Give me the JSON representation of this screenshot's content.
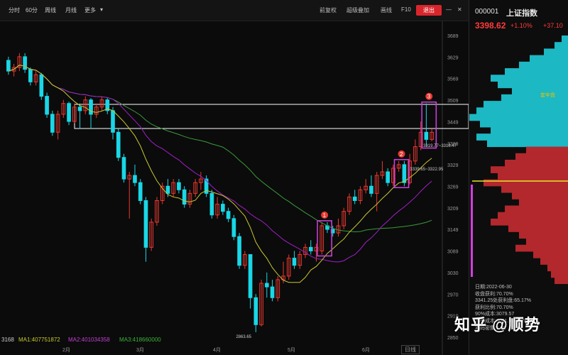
{
  "toolbar": {
    "left": [
      "分时",
      "60分",
      "周线",
      "月线",
      "更多"
    ],
    "right": [
      "前复权",
      "超级叠加",
      "画线",
      "F10"
    ],
    "close_label": "退出"
  },
  "stock": {
    "code": "000001",
    "name": "上证指数",
    "price": "3398.62",
    "pct": "+1.10%",
    "change": "+37.10"
  },
  "side_info": {
    "date": "日期:2022-06-30",
    "profit": "收盘获利:70.70%",
    "range1": "3341.25处获利盘:65.17%",
    "avg": "获利比例:70.70%",
    "line4": "90%成本:3079.57",
    "line5": "70%成本:3091.96-3478.10",
    "line6": "筹码密集:1.60"
  },
  "profile_label": "套牢盘",
  "watermark": "知乎 @顺势",
  "bottom_button": "日线",
  "legend": {
    "value": "3168",
    "ma1": "MA1:407751872",
    "ma2": "MA2:401034358",
    "ma3": "MA3:418660000"
  },
  "colors": {
    "up": "#e8382f",
    "down": "#19d7e6",
    "ma_yellow": "#c8c832",
    "ma_purple": "#a020c8",
    "ma_green": "#3c9a3c",
    "box_white": "#ffffff",
    "highlight": "#d040e0"
  },
  "annotations": {
    "low_label": "2863.65",
    "label2": "3339.65~3322.95",
    "label3": "3319.77~3318.47",
    "markers": [
      "1",
      "2",
      "3"
    ]
  },
  "chart_data": {
    "type": "candlestick",
    "title": "",
    "x_tick_labels": [
      "2月",
      "3月",
      "4月",
      "5月",
      "6月"
    ],
    "y_tick_labels": [
      "3689",
      "3629",
      "3569",
      "3509",
      "3449",
      "3389",
      "3329",
      "3269",
      "3209",
      "3149",
      "3089",
      "3030",
      "2970",
      "2910",
      "2850"
    ],
    "ylim": [
      2850,
      3689
    ],
    "candles": [
      {
        "o": 3620,
        "c": 3590,
        "h": 3630,
        "l": 3580
      },
      {
        "o": 3590,
        "c": 3600,
        "h": 3610,
        "l": 3575
      },
      {
        "o": 3600,
        "c": 3630,
        "h": 3640,
        "l": 3590
      },
      {
        "o": 3630,
        "c": 3595,
        "h": 3640,
        "l": 3585
      },
      {
        "o": 3595,
        "c": 3560,
        "h": 3600,
        "l": 3550
      },
      {
        "o": 3560,
        "c": 3580,
        "h": 3590,
        "l": 3550
      },
      {
        "o": 3580,
        "c": 3520,
        "h": 3585,
        "l": 3510
      },
      {
        "o": 3520,
        "c": 3470,
        "h": 3530,
        "l": 3460
      },
      {
        "o": 3470,
        "c": 3420,
        "h": 3480,
        "l": 3410
      },
      {
        "o": 3420,
        "c": 3470,
        "h": 3480,
        "l": 3400
      },
      {
        "o": 3470,
        "c": 3500,
        "h": 3510,
        "l": 3460
      },
      {
        "o": 3500,
        "c": 3450,
        "h": 3505,
        "l": 3440
      },
      {
        "o": 3450,
        "c": 3490,
        "h": 3500,
        "l": 3445
      },
      {
        "o": 3490,
        "c": 3480,
        "h": 3500,
        "l": 3430
      },
      {
        "o": 3480,
        "c": 3510,
        "h": 3520,
        "l": 3470
      },
      {
        "o": 3510,
        "c": 3470,
        "h": 3515,
        "l": 3430
      },
      {
        "o": 3470,
        "c": 3490,
        "h": 3500,
        "l": 3460
      },
      {
        "o": 3490,
        "c": 3510,
        "h": 3520,
        "l": 3480
      },
      {
        "o": 3510,
        "c": 3480,
        "h": 3515,
        "l": 3470
      },
      {
        "o": 3480,
        "c": 3420,
        "h": 3490,
        "l": 3400
      },
      {
        "o": 3420,
        "c": 3350,
        "h": 3430,
        "l": 3340
      },
      {
        "o": 3350,
        "c": 3290,
        "h": 3360,
        "l": 3280
      },
      {
        "o": 3290,
        "c": 3300,
        "h": 3310,
        "l": 3180
      },
      {
        "o": 3300,
        "c": 3280,
        "h": 3330,
        "l": 3270
      },
      {
        "o": 3280,
        "c": 3230,
        "h": 3290,
        "l": 3220
      },
      {
        "o": 3230,
        "c": 3100,
        "h": 3240,
        "l": 3060
      },
      {
        "o": 3100,
        "c": 3170,
        "h": 3180,
        "l": 3090
      },
      {
        "o": 3170,
        "c": 3230,
        "h": 3240,
        "l": 3160
      },
      {
        "o": 3230,
        "c": 3270,
        "h": 3280,
        "l": 3220
      },
      {
        "o": 3270,
        "c": 3250,
        "h": 3290,
        "l": 3240
      },
      {
        "o": 3250,
        "c": 3280,
        "h": 3290,
        "l": 3240
      },
      {
        "o": 3280,
        "c": 3260,
        "h": 3290,
        "l": 3250
      },
      {
        "o": 3260,
        "c": 3220,
        "h": 3270,
        "l": 3210
      },
      {
        "o": 3220,
        "c": 3250,
        "h": 3260,
        "l": 3210
      },
      {
        "o": 3250,
        "c": 3280,
        "h": 3290,
        "l": 3240
      },
      {
        "o": 3280,
        "c": 3290,
        "h": 3310,
        "l": 3260
      },
      {
        "o": 3290,
        "c": 3250,
        "h": 3300,
        "l": 3240
      },
      {
        "o": 3250,
        "c": 3190,
        "h": 3260,
        "l": 3180
      },
      {
        "o": 3190,
        "c": 3220,
        "h": 3240,
        "l": 3180
      },
      {
        "o": 3220,
        "c": 3200,
        "h": 3230,
        "l": 3190
      },
      {
        "o": 3200,
        "c": 3180,
        "h": 3210,
        "l": 3170
      },
      {
        "o": 3180,
        "c": 3130,
        "h": 3190,
        "l": 3120
      },
      {
        "o": 3130,
        "c": 3050,
        "h": 3140,
        "l": 3040
      },
      {
        "o": 3050,
        "c": 3080,
        "h": 3090,
        "l": 3040
      },
      {
        "o": 3080,
        "c": 2960,
        "h": 3080,
        "l": 2930
      },
      {
        "o": 2960,
        "c": 2885,
        "h": 2970,
        "l": 2864
      },
      {
        "o": 2885,
        "c": 3000,
        "h": 3010,
        "l": 2880
      },
      {
        "o": 3000,
        "c": 2990,
        "h": 3030,
        "l": 2960
      },
      {
        "o": 2990,
        "c": 2960,
        "h": 3010,
        "l": 2950
      },
      {
        "o": 2960,
        "c": 3010,
        "h": 3020,
        "l": 2950
      },
      {
        "o": 3010,
        "c": 3020,
        "h": 3060,
        "l": 3000
      },
      {
        "o": 3020,
        "c": 3070,
        "h": 3080,
        "l": 3010
      },
      {
        "o": 3070,
        "c": 3050,
        "h": 3090,
        "l": 3040
      },
      {
        "o": 3050,
        "c": 3080,
        "h": 3090,
        "l": 3040
      },
      {
        "o": 3080,
        "c": 3100,
        "h": 3110,
        "l": 3070
      },
      {
        "o": 3100,
        "c": 3090,
        "h": 3120,
        "l": 3080
      },
      {
        "o": 3090,
        "c": 3100,
        "h": 3110,
        "l": 3060
      },
      {
        "o": 3090,
        "c": 3160,
        "h": 3170,
        "l": 3080
      },
      {
        "o": 3160,
        "c": 3150,
        "h": 3170,
        "l": 3140
      },
      {
        "o": 3150,
        "c": 3140,
        "h": 3160,
        "l": 3130
      },
      {
        "o": 3140,
        "c": 3160,
        "h": 3180,
        "l": 3130
      },
      {
        "o": 3160,
        "c": 3200,
        "h": 3210,
        "l": 3150
      },
      {
        "o": 3200,
        "c": 3240,
        "h": 3250,
        "l": 3190
      },
      {
        "o": 3240,
        "c": 3230,
        "h": 3260,
        "l": 3220
      },
      {
        "o": 3230,
        "c": 3260,
        "h": 3270,
        "l": 3220
      },
      {
        "o": 3260,
        "c": 3270,
        "h": 3290,
        "l": 3250
      },
      {
        "o": 3270,
        "c": 3250,
        "h": 3300,
        "l": 3240
      },
      {
        "o": 3250,
        "c": 3300,
        "h": 3310,
        "l": 3200
      },
      {
        "o": 3300,
        "c": 3310,
        "h": 3340,
        "l": 3290
      },
      {
        "o": 3310,
        "c": 3280,
        "h": 3320,
        "l": 3270
      },
      {
        "o": 3280,
        "c": 3320,
        "h": 3330,
        "l": 3270
      },
      {
        "o": 3320,
        "c": 3330,
        "h": 3340,
        "l": 3310
      },
      {
        "o": 3330,
        "c": 3280,
        "h": 3340,
        "l": 3270
      },
      {
        "o": 3280,
        "c": 3340,
        "h": 3360,
        "l": 3275
      },
      {
        "o": 3340,
        "c": 3380,
        "h": 3400,
        "l": 3330
      },
      {
        "o": 3380,
        "c": 3420,
        "h": 3450,
        "l": 3370
      },
      {
        "o": 3420,
        "c": 3400,
        "h": 3500,
        "l": 3380
      },
      {
        "o": 3400,
        "c": 3420,
        "h": 3430,
        "l": 3395
      }
    ]
  }
}
